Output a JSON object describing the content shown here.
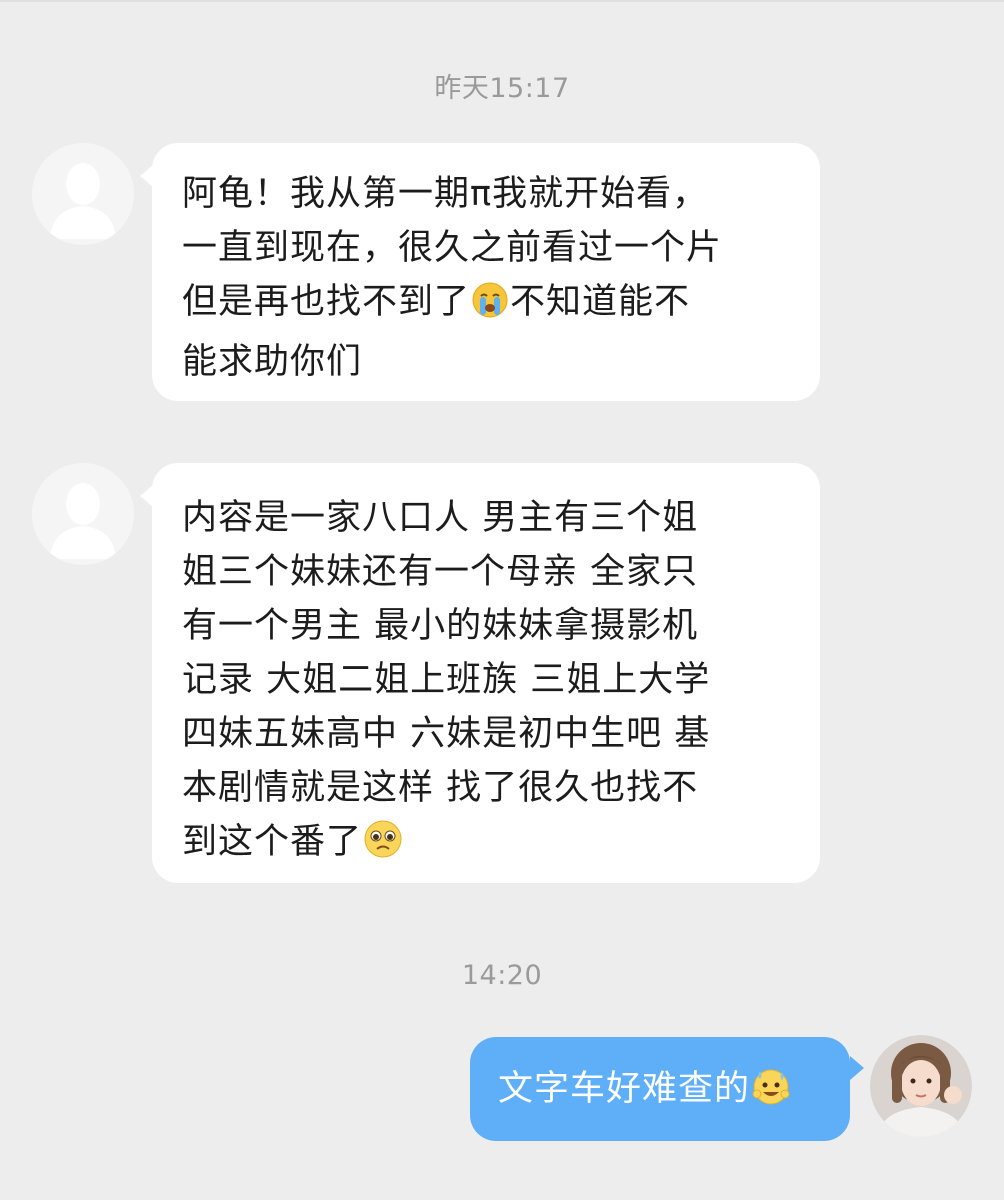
{
  "conversation": {
    "messages": [
      {
        "type": "timestamp",
        "text": "昨天15:17"
      },
      {
        "type": "incoming",
        "lines": [
          "阿龟！我从第一期π我就开始看，",
          "一直到现在，很久之前看过一个片",
          "但是再也找不到了",
          "能求助你们"
        ],
        "line3_after_emoji": "不知道能不",
        "emoji": "loudly-crying-emoji"
      },
      {
        "type": "incoming",
        "lines": [
          "内容是一家八口人 男主有三个姐",
          "姐三个妹妹还有一个母亲 全家只",
          "有一个男主 最小的妹妹拿摄影机",
          "记录 大姐二姐上班族 三姐上大学",
          "四妹五妹高中 六妹是初中生吧 基",
          "本剧情就是这样 找了很久也找不",
          "到这个番了"
        ],
        "emoji": "pleading-face-emoji"
      },
      {
        "type": "timestamp",
        "text": "14:20"
      },
      {
        "type": "outgoing",
        "text": "文字车好难查的",
        "emoji": "sweat-smile-emoji"
      }
    ]
  },
  "colors": {
    "background": "#ededed",
    "incoming_bubble": "#ffffff",
    "outgoing_bubble": "#5eaef8",
    "timestamp_text": "#9a9a9a"
  }
}
